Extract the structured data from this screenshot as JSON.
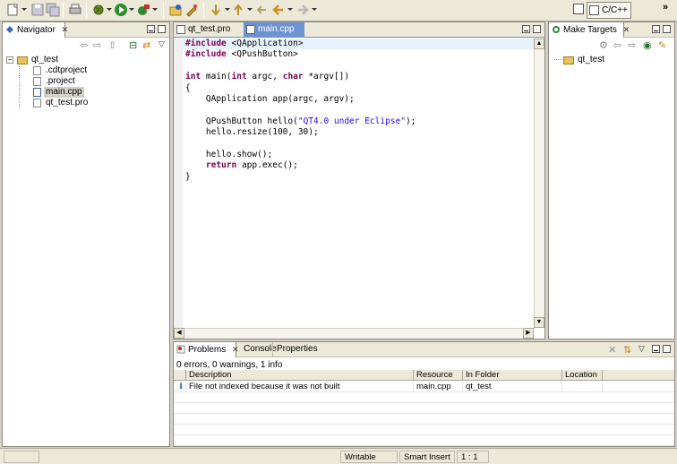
{
  "toolbar": {
    "icons": [
      "new-icon",
      "save-icon",
      "save-all-icon",
      "print-icon",
      "build-icon",
      "debug-icon",
      "run-icon",
      "external-tools-icon",
      "new-project-icon",
      "open-type-icon",
      "next-annotation-icon",
      "previous-annotation-icon",
      "back-icon",
      "forward-icon"
    ],
    "perspective_label": "C/C++"
  },
  "navigator": {
    "tab_label": "Navigator",
    "project": "qt_test",
    "files": [
      ".cdtproject",
      ".project",
      "main.cpp",
      "qt_test.pro"
    ],
    "selected": "main.cpp"
  },
  "editor": {
    "tabs": [
      {
        "label": "qt_test.pro",
        "active": false
      },
      {
        "label": "main.cpp",
        "active": true
      }
    ],
    "code_lines": [
      "#include <QApplication>",
      "#include <QPushButton>",
      "",
      "int main(int argc, char *argv[])",
      "{",
      "    QApplication app(argc, argv);",
      "",
      "    QPushButton hello(\"QT4.0 under Eclipse\");",
      "    hello.resize(100, 30);",
      "",
      "    hello.show();",
      "    return app.exec();",
      "}"
    ]
  },
  "make_targets": {
    "tab_label": "Make Targets",
    "project": "qt_test"
  },
  "problems": {
    "tabs": [
      "Problems",
      "Console",
      "Properties"
    ],
    "summary": "0 errors, 0 warnings, 1 info",
    "columns": [
      "Description",
      "Resource",
      "In Folder",
      "Location"
    ],
    "rows": [
      {
        "description": "File not indexed because it was not built",
        "resource": "main.cpp",
        "folder": "qt_test",
        "location": ""
      }
    ]
  },
  "statusbar": {
    "mode": "Writable",
    "insert": "Smart Insert",
    "position": "1 : 1"
  }
}
